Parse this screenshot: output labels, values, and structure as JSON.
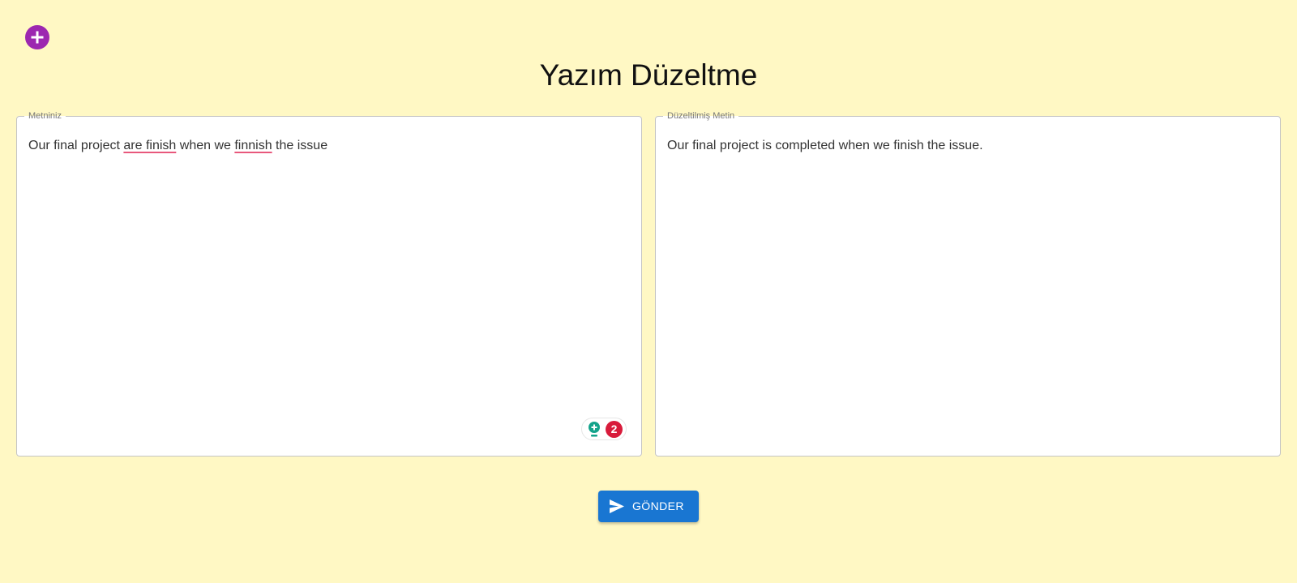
{
  "header": {
    "title": "Yazım Düzeltme",
    "add_icon": "plus-circle-icon"
  },
  "input_panel": {
    "label": "Metniniz",
    "text_parts": [
      "Our final project ",
      "are finish",
      " when we ",
      "finnish",
      " the issue"
    ],
    "grammar_widget": {
      "icon": "lightbulb-icon",
      "issue_count": "2"
    }
  },
  "output_panel": {
    "label": "Düzeltilmiş Metin",
    "text": "Our final project is completed when we finish the issue."
  },
  "actions": {
    "send_label": "GÖNDER",
    "send_icon": "send-icon"
  },
  "colors": {
    "background": "#fff8c4",
    "add_button": "#9c27b0",
    "primary": "#1976d2",
    "badge": "#d81b3b",
    "spellcheck_underline": "#e8587c"
  }
}
